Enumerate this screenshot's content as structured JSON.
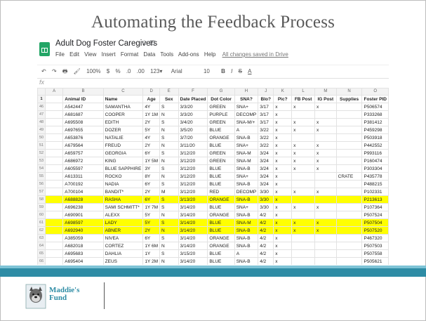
{
  "slide": {
    "title": "Automating the Feedback Process"
  },
  "app": {
    "doc_title": "Adult Dog Foster Caregivers",
    "title_icons": "☆ ⊡",
    "menu": [
      "File",
      "Edit",
      "View",
      "Insert",
      "Format",
      "Data",
      "Tools",
      "Add-ons",
      "Help"
    ],
    "saved_status": "All changes saved in Drive"
  },
  "toolbar": {
    "undo": "↶",
    "redo": "↷",
    "print": "🖶",
    "paint": "🖌",
    "zoom": "100%",
    "currency": "$",
    "percent": "%",
    "dec_less": ".0",
    "dec_more": ".00",
    "format": "123▾",
    "font": "Arial",
    "font_size": "10",
    "bold": "B",
    "italic": "I",
    "strike": "S",
    "color": "A"
  },
  "formula_bar": {
    "fx": "fx"
  },
  "grid": {
    "column_letters": [
      "A",
      "B",
      "C",
      "D",
      "E",
      "F",
      "G",
      "H",
      "J",
      "K",
      "L",
      "M",
      "N",
      "O"
    ],
    "header_row_number": "1",
    "headers": [
      "Animal ID",
      "Name",
      "Age",
      "Sex",
      "Date Placed",
      "Dot Color",
      "SNA?",
      "Blo?",
      "Pic?",
      "FB Post",
      "IG Post",
      "Supplies",
      "Foster PID"
    ],
    "rows": [
      {
        "n": "46",
        "id": "A542447",
        "name": "SAMANTHA",
        "age": "4Y",
        "sex": "S",
        "date": "3/3/20",
        "dot": "GREEN",
        "sna": "SNA+",
        "blo": "3/17",
        "pic": "x",
        "fb": "x",
        "ig": "x",
        "sup": "",
        "pid": "P506574",
        "hl": false
      },
      {
        "n": "47",
        "id": "A681687",
        "name": "COOPER",
        "age": "1Y 1M",
        "sex": "N",
        "date": "3/3/20",
        "dot": "PURPLE",
        "sna": "DECOMP",
        "blo": "3/17",
        "pic": "x",
        "fb": "",
        "ig": "",
        "sup": "",
        "pid": "P333268",
        "hl": false
      },
      {
        "n": "48",
        "id": "A695508",
        "name": "EDITH",
        "age": "2Y",
        "sex": "S",
        "date": "3/4/20",
        "dot": "GREEN",
        "sna": "SNA-M/+",
        "blo": "3/17",
        "pic": "x",
        "fb": "x",
        "ig": "x",
        "sup": "",
        "pid": "P381412",
        "hl": false
      },
      {
        "n": "49",
        "id": "A697655",
        "name": "DOZER",
        "age": "5Y",
        "sex": "N",
        "date": "3/5/20",
        "dot": "BLUE",
        "sna": "A",
        "blo": "3/22",
        "pic": "x",
        "fb": "x",
        "ig": "x",
        "sup": "",
        "pid": "P459298",
        "hl": false
      },
      {
        "n": "50",
        "id": "A653876",
        "name": "NATALIE",
        "age": "4Y",
        "sex": "S",
        "date": "3/7/20",
        "dot": "ORANGE",
        "sna": "SNA-B",
        "blo": "3/22",
        "pic": "x",
        "fb": "",
        "ig": "",
        "sup": "",
        "pid": "P503918",
        "hl": false
      },
      {
        "n": "51",
        "id": "A679564",
        "name": "FREUD",
        "age": "2Y",
        "sex": "N",
        "date": "3/11/20",
        "dot": "BLUE",
        "sna": "SNA+",
        "blo": "3/22",
        "pic": "x",
        "fb": "x",
        "ig": "x",
        "sup": "",
        "pid": "P442552",
        "hl": false
      },
      {
        "n": "52",
        "id": "A659757",
        "name": "GEORGIA",
        "age": "6Y",
        "sex": "S",
        "date": "3/12/20",
        "dot": "GREEN",
        "sna": "SNA-M",
        "blo": "3/24",
        "pic": "x",
        "fb": "x",
        "ig": "x",
        "sup": "",
        "pid": "P993116",
        "hl": false
      },
      {
        "n": "53",
        "id": "A686972",
        "name": "KING",
        "age": "1Y 5M",
        "sex": "N",
        "date": "3/12/20",
        "dot": "GREEN",
        "sna": "SNA-M",
        "blo": "3/24",
        "pic": "x",
        "fb": "x",
        "ig": "x",
        "sup": "",
        "pid": "P160474",
        "hl": false
      },
      {
        "n": "54",
        "id": "A605597",
        "name": "BLUE SAPPHIRE",
        "age": "3Y",
        "sex": "S",
        "date": "3/12/20",
        "dot": "BLUE",
        "sna": "SNA-B",
        "blo": "3/24",
        "pic": "x",
        "fb": "x",
        "ig": "x",
        "sup": "",
        "pid": "P303304",
        "hl": false
      },
      {
        "n": "55",
        "id": "A613311",
        "name": "ROCKO",
        "age": "8Y",
        "sex": "N",
        "date": "3/12/20",
        "dot": "BLUE",
        "sna": "SNA+",
        "blo": "3/24",
        "pic": "x",
        "fb": "",
        "ig": "",
        "sup": "CRATE",
        "pid": "P435778",
        "hl": false
      },
      {
        "n": "56",
        "id": "A700192",
        "name": "NADIA",
        "age": "6Y",
        "sex": "S",
        "date": "3/12/20",
        "dot": "BLUE",
        "sna": "SNA-B",
        "blo": "3/24",
        "pic": "x",
        "fb": "",
        "ig": "",
        "sup": "",
        "pid": "P488215",
        "hl": false
      },
      {
        "n": "57",
        "id": "A700104",
        "name": "BANDIT*",
        "age": "2Y",
        "sex": "M",
        "date": "3/12/20",
        "dot": "RED",
        "sna": "DECOMP",
        "blo": "3/30",
        "pic": "x",
        "fb": "x",
        "ig": "x",
        "sup": "",
        "pid": "P102331",
        "hl": false
      },
      {
        "n": "58",
        "id": "A688828",
        "name": "RASHA",
        "age": "6Y",
        "sex": "S",
        "date": "3/13/20",
        "dot": "ORANGE",
        "sna": "SNA-B",
        "blo": "3/30",
        "pic": "x",
        "fb": "",
        "ig": "",
        "sup": "",
        "pid": "P213613",
        "hl": true
      },
      {
        "n": "59",
        "id": "A696238",
        "name": "SAMI SCHMITT*",
        "age": "1Y 7M",
        "sex": "S",
        "date": "3/14/20",
        "dot": "BLUE",
        "sna": "SNA+",
        "blo": "3/30",
        "pic": "x",
        "fb": "x",
        "ig": "x",
        "sup": "",
        "pid": "P107364",
        "hl": false
      },
      {
        "n": "60",
        "id": "A690901",
        "name": "ALEXX",
        "age": "5Y",
        "sex": "N",
        "date": "3/14/20",
        "dot": "ORANGE",
        "sna": "SNA-B",
        "blo": "4/2",
        "pic": "x",
        "fb": "",
        "ig": "",
        "sup": "",
        "pid": "P507524",
        "hl": false
      },
      {
        "n": "61",
        "id": "A698597",
        "name": "LADY",
        "age": "5Y",
        "sex": "S",
        "date": "3/14/20",
        "dot": "BLUE",
        "sna": "SNA-M",
        "blo": "4/2",
        "pic": "x",
        "fb": "x",
        "ig": "x",
        "sup": "",
        "pid": "P507504",
        "hl": true
      },
      {
        "n": "62",
        "id": "A692940",
        "name": "ABNER",
        "age": "2Y",
        "sex": "N",
        "date": "3/14/20",
        "dot": "BLUE",
        "sna": "SNA-B",
        "blo": "4/2",
        "pic": "x",
        "fb": "x",
        "ig": "x",
        "sup": "",
        "pid": "P507520",
        "hl": true
      },
      {
        "n": "63",
        "id": "A385059",
        "name": "NIVEA",
        "age": "6Y",
        "sex": "S",
        "date": "3/14/20",
        "dot": "ORANGE",
        "sna": "SNA-B",
        "blo": "4/2",
        "pic": "x",
        "fb": "",
        "ig": "",
        "sup": "",
        "pid": "P467320",
        "hl": false
      },
      {
        "n": "64",
        "id": "A682018",
        "name": "CORTEZ",
        "age": "1Y 6M",
        "sex": "N",
        "date": "3/14/20",
        "dot": "ORANGE",
        "sna": "SNA-B",
        "blo": "4/2",
        "pic": "x",
        "fb": "",
        "ig": "",
        "sup": "",
        "pid": "P507503",
        "hl": false
      },
      {
        "n": "65",
        "id": "A695683",
        "name": "DAHLIA",
        "age": "1Y",
        "sex": "S",
        "date": "3/15/20",
        "dot": "BLUE",
        "sna": "A",
        "blo": "4/2",
        "pic": "x",
        "fb": "",
        "ig": "",
        "sup": "",
        "pid": "P507558",
        "hl": false
      },
      {
        "n": "66",
        "id": "A695404",
        "name": "ZEUS",
        "age": "1Y 2M",
        "sex": "N",
        "date": "3/14/20",
        "dot": "BLUE",
        "sna": "SNA-B",
        "blo": "4/2",
        "pic": "x",
        "fb": "",
        "ig": "",
        "sup": "",
        "pid": "P505621",
        "hl": false
      }
    ]
  },
  "footer": {
    "logo_line1": "Maddie's",
    "logo_line2": "Fund"
  },
  "colors": {
    "band": "#2e8ca5",
    "band_light": "#7ec3d6",
    "highlight": "#ffff00",
    "sheets_green": "#23a566"
  }
}
